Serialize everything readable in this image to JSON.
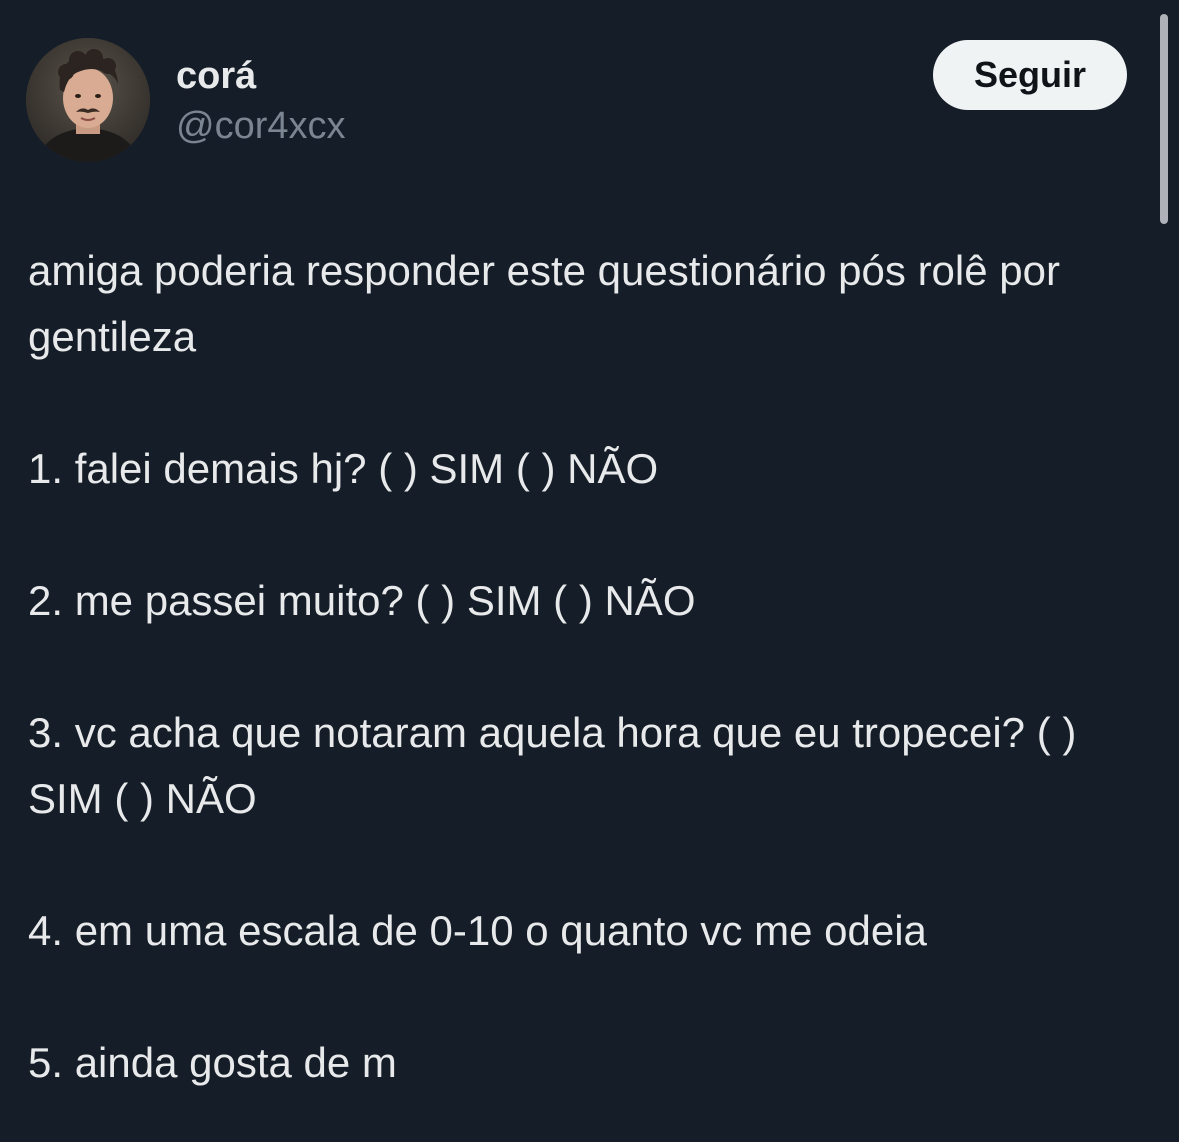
{
  "author": {
    "display_name": "corá",
    "handle": "@cor4xcx",
    "avatar_icon": "profile-photo"
  },
  "follow_button": {
    "label": "Seguir"
  },
  "tweet": {
    "intro": "amiga poderia responder este questionário pós rolê por gentileza",
    "q1": "1. falei demais hj? ( ) SIM ( ) NÃO",
    "q2": "2. me passei muito? ( ) SIM ( ) NÃO",
    "q3": "3. vc acha que notaram aquela hora que eu tropecei? ( ) SIM ( ) NÃO",
    "q4": "4. em uma escala de 0-10 o quanto vc me odeia",
    "q5": "5. ainda gosta de m"
  },
  "colors": {
    "background": "#151d28",
    "text": "#e7e9ea",
    "muted": "#7a8591",
    "button_bg": "#eff3f4"
  }
}
